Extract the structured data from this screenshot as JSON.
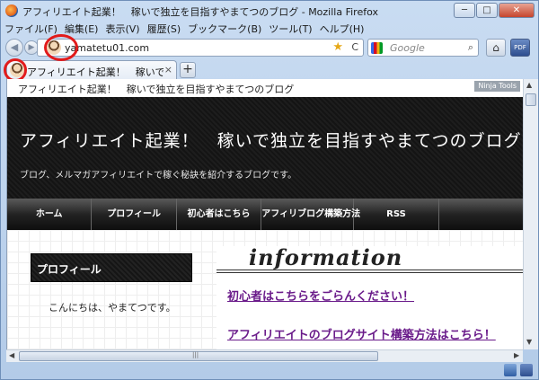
{
  "window": {
    "title": "アフィリエイト起業！　稼いで独立を目指すやまてつのブログ - Mozilla Firefox",
    "minimize": "─",
    "maximize": "□",
    "close": "✕"
  },
  "menu": [
    "ファイル(F)",
    "編集(E)",
    "表示(V)",
    "履歴(S)",
    "ブックマーク(B)",
    "ツール(T)",
    "ヘルプ(H)"
  ],
  "nav": {
    "back": "◀",
    "forward": "▶",
    "url": "yamatetu01.com",
    "star": "★",
    "reload": "C",
    "search_placeholder": "Google",
    "search_icon": "⌕",
    "home": "⌂",
    "addon": "PDF"
  },
  "tab": {
    "label": "アフィリエイト起業！　稼いで独立を…",
    "close": "×",
    "new": "+"
  },
  "page": {
    "topline": "アフィリエイト起業！　稼いで独立を目指すやまてつのブログ",
    "ninja_tools": "Ninja Tools",
    "site_title": "アフィリエイト起業！　稼いで独立を目指すやまてつのブログ",
    "site_desc": "ブログ、メルマガアフィリエイトで稼ぐ秘訣を紹介するブログです。",
    "global_nav": [
      "ホーム",
      "プロフィール",
      "初心者はこちら",
      "アフィリブログ構築方法",
      "RSS",
      ""
    ],
    "sidebar_title": "プロフィール",
    "sidebar_greeting": "こんにちは、やまてつです。",
    "info_title": "information",
    "links": [
      "初心者はこちらをごらんください！",
      "アフィリエイトのブログサイト構築方法はこちら！"
    ]
  },
  "scroll": {
    "up": "▲",
    "down": "▼",
    "left": "◀",
    "right": "▶",
    "grip": "|||"
  },
  "colors": {
    "annotation": "#e21b1b",
    "link": "#6a1b8a",
    "header_bg": "#141414"
  }
}
